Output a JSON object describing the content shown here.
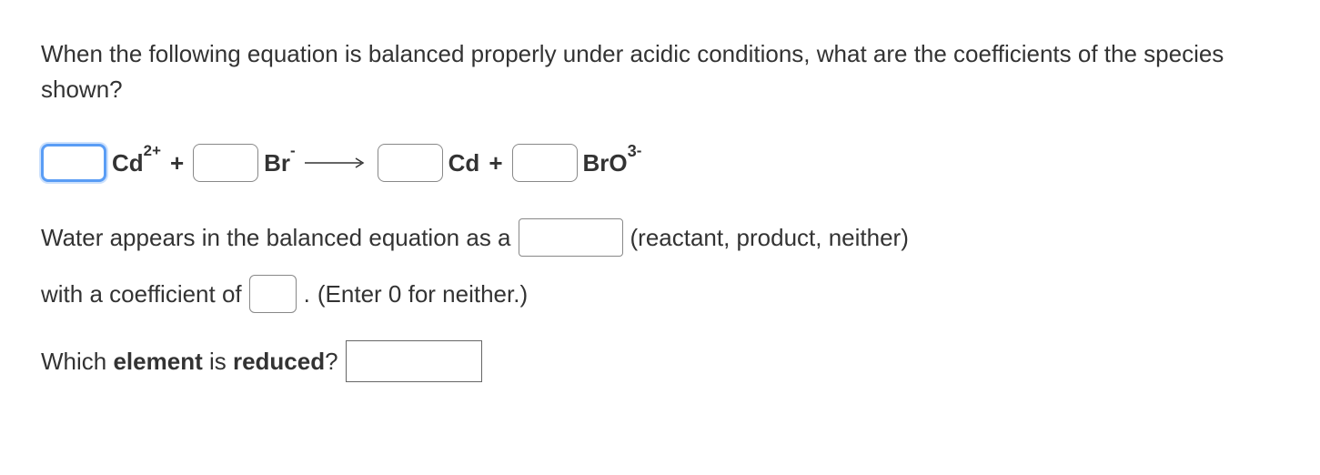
{
  "question": "When the following equation is balanced properly under acidic conditions, what are the coefficients of the species shown?",
  "equation": {
    "species1": {
      "base": "Cd",
      "sup": "2+"
    },
    "plus1": "+",
    "species2": {
      "base": "Br",
      "sup": "-"
    },
    "species3": {
      "base": "Cd",
      "sup": ""
    },
    "plus2": "+",
    "species4": {
      "base": "BrO",
      "sub": "3",
      "sup": "-"
    }
  },
  "water_line": {
    "prefix": "Water appears in the balanced equation as a",
    "hint": "(reactant, product, neither)"
  },
  "coeff_line": {
    "prefix": "with a coefficient of",
    "period": ".",
    "hint": "(Enter 0 for neither.)"
  },
  "reduced_line": {
    "prefix": "Which ",
    "bold1": "element",
    "mid": " is ",
    "bold2": "reduced",
    "suffix": "?"
  }
}
